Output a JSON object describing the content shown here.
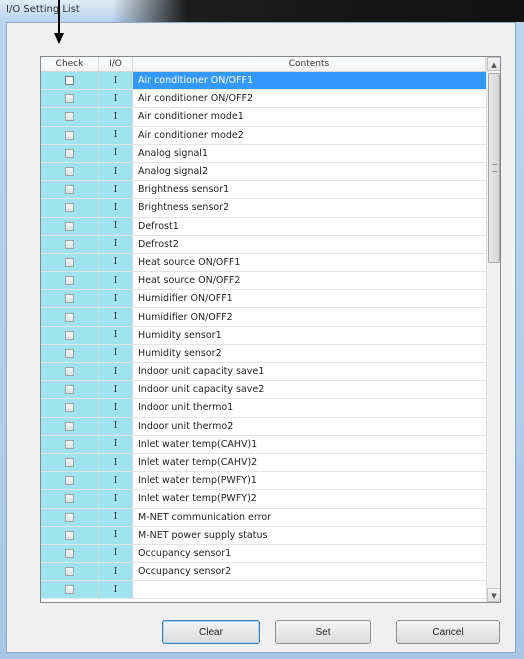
{
  "window": {
    "title": "I/O Setting List"
  },
  "columns": {
    "check": "Check",
    "io": "I/O",
    "contents": "Contents"
  },
  "rows": [
    {
      "io": "I",
      "contents": "Air conditioner ON/OFF1",
      "selected": true
    },
    {
      "io": "I",
      "contents": "Air conditioner ON/OFF2"
    },
    {
      "io": "I",
      "contents": "Air conditioner mode1"
    },
    {
      "io": "I",
      "contents": "Air conditioner mode2"
    },
    {
      "io": "I",
      "contents": "Analog signal1"
    },
    {
      "io": "I",
      "contents": "Analog signal2"
    },
    {
      "io": "I",
      "contents": "Brightness sensor1"
    },
    {
      "io": "I",
      "contents": "Brightness sensor2"
    },
    {
      "io": "I",
      "contents": "Defrost1"
    },
    {
      "io": "I",
      "contents": "Defrost2"
    },
    {
      "io": "I",
      "contents": "Heat source ON/OFF1"
    },
    {
      "io": "I",
      "contents": "Heat source ON/OFF2"
    },
    {
      "io": "I",
      "contents": "Humidifier ON/OFF1"
    },
    {
      "io": "I",
      "contents": "Humidifier ON/OFF2"
    },
    {
      "io": "I",
      "contents": "Humidity sensor1"
    },
    {
      "io": "I",
      "contents": "Humidity sensor2"
    },
    {
      "io": "I",
      "contents": "Indoor unit capacity save1"
    },
    {
      "io": "I",
      "contents": "Indoor unit capacity save2"
    },
    {
      "io": "I",
      "contents": "Indoor unit thermo1"
    },
    {
      "io": "I",
      "contents": "Indoor unit thermo2"
    },
    {
      "io": "I",
      "contents": "Inlet water temp(CAHV)1"
    },
    {
      "io": "I",
      "contents": "Inlet water temp(CAHV)2"
    },
    {
      "io": "I",
      "contents": "Inlet water temp(PWFY)1"
    },
    {
      "io": "I",
      "contents": "Inlet water temp(PWFY)2"
    },
    {
      "io": "I",
      "contents": "M-NET communication error"
    },
    {
      "io": "I",
      "contents": "M-NET power supply status"
    },
    {
      "io": "I",
      "contents": "Occupancy sensor1"
    },
    {
      "io": "I",
      "contents": "Occupancy sensor2"
    },
    {
      "io": "I",
      "contents": ""
    }
  ],
  "buttons": {
    "clear": "Clear",
    "set": "Set",
    "cancel": "Cancel"
  },
  "scrollbar": {
    "up": "▲",
    "down": "▼"
  }
}
